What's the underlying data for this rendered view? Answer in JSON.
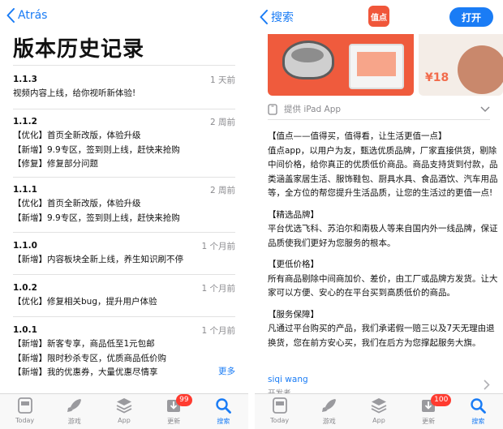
{
  "left": {
    "back_label": "Atrás",
    "title": "版本历史记录",
    "versions": [
      {
        "number": "1.1.3",
        "date": "1 天前",
        "lines": [
          "视频内容上线，给你视听新体验!"
        ]
      },
      {
        "number": "1.1.2",
        "date": "2 周前",
        "lines": [
          "【优化】首页全新改版，体验升级",
          "【新增】9.9专区，签到则上线，赶快来抢购",
          "【修复】修复部分问题"
        ]
      },
      {
        "number": "1.1.1",
        "date": "2 周前",
        "lines": [
          "【优化】首页全新改版，体验升级",
          "【新增】9.9专区，签到则上线，赶快来抢购"
        ]
      },
      {
        "number": "1.1.0",
        "date": "1 个月前",
        "lines": [
          "【新增】内容板块全新上线，养生知识刷不停"
        ]
      },
      {
        "number": "1.0.2",
        "date": "1 个月前",
        "lines": [
          "【优化】修复相关bug，提升用户体验"
        ]
      },
      {
        "number": "1.0.1",
        "date": "1 个月前",
        "lines": [
          "【新增】新客专享，商品低至1元包邮",
          "【新增】限时秒杀专区，优质商品低价购",
          "【新增】我的优惠券，大量优惠尽情享"
        ]
      }
    ],
    "more_label": "更多",
    "tabbar": {
      "today": "Today",
      "games": "游戏",
      "apps": "App",
      "updates": "更新",
      "search": "搜索",
      "updates_badge": "99"
    }
  },
  "right": {
    "back_label": "搜索",
    "app_icon_text": "值点",
    "open_label": "打开",
    "screenshot_price": "¥18",
    "ipad_label": "提供 iPad App",
    "description": [
      "【值点——值得买，值得看，让生活更值一点】",
      "值点app，以用户为友，甄选优质品牌，厂家直接供货，剔除",
      "中间价格，给你真正的优质低价商品。商品支持货到付款，品",
      "类涵盖家居生活、服饰鞋包、厨具水具、食品酒饮、汽车用品",
      "等，全方位的帮您提升生活品质，让您的生活过的更值一点!",
      "【精选品牌】",
      "平台优选飞科、苏泊尔和南极人等来自国内外一线品牌，保证",
      "品质使我们更好为您服务的根本。",
      "【更低价格】",
      "所有商品剔除中间商加价、差价，由工厂或品牌方发货。让大",
      "家可以方便、安心的在平台买到高质低价的商品。",
      "【服务保障】",
      "凡通过平台购买的产品，我们承诺假一赔三以及7天无理由退",
      "换货，您在前方安心买，我们在后方为您撑起服务大旗。"
    ],
    "developer_name": "siqi wang",
    "developer_role": "开发者",
    "tabbar": {
      "today": "Today",
      "games": "游戏",
      "apps": "App",
      "updates": "更新",
      "search": "搜索",
      "updates_badge": "100"
    }
  }
}
